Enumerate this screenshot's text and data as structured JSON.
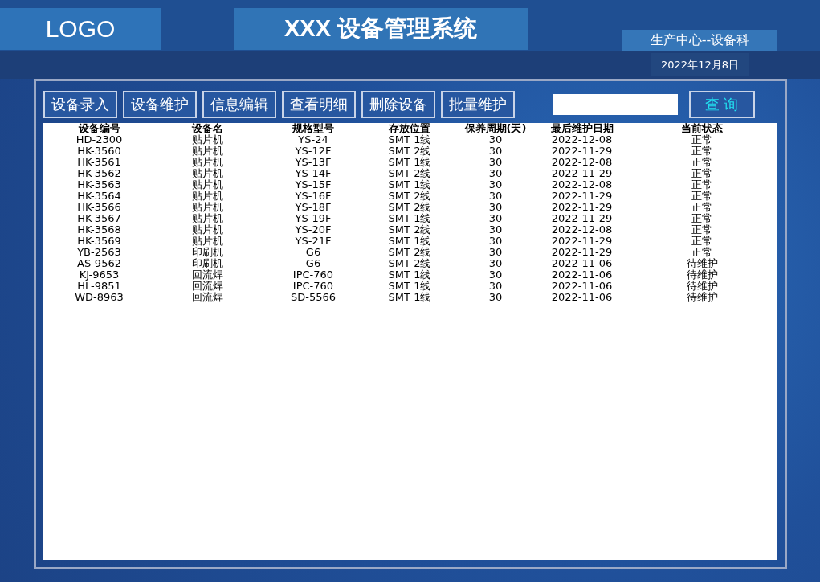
{
  "header": {
    "logo": "LOGO",
    "title": "XXX 设备管理系统",
    "department": "生产中心--设备科",
    "date": "2022年12月8日"
  },
  "toolbar": {
    "buttons": [
      "设备录入",
      "设备维护",
      "信息编辑",
      "查看明细",
      "删除设备",
      "批量维护"
    ],
    "query_button": "查 询"
  },
  "table": {
    "columns": [
      "设备编号",
      "设备名",
      "规格型号",
      "存放位置",
      "保养周期(天)",
      "最后维护日期",
      "当前状态"
    ],
    "rows": [
      [
        "HD-2300",
        "贴片机",
        "YS-24",
        "SMT 1线",
        "30",
        "2022-12-08",
        "正常"
      ],
      [
        "HK-3560",
        "贴片机",
        "YS-12F",
        "SMT 2线",
        "30",
        "2022-11-29",
        "正常"
      ],
      [
        "HK-3561",
        "贴片机",
        "YS-13F",
        "SMT 1线",
        "30",
        "2022-12-08",
        "正常"
      ],
      [
        "HK-3562",
        "贴片机",
        "YS-14F",
        "SMT 2线",
        "30",
        "2022-11-29",
        "正常"
      ],
      [
        "HK-3563",
        "贴片机",
        "YS-15F",
        "SMT 1线",
        "30",
        "2022-12-08",
        "正常"
      ],
      [
        "HK-3564",
        "贴片机",
        "YS-16F",
        "SMT 2线",
        "30",
        "2022-11-29",
        "正常"
      ],
      [
        "HK-3566",
        "贴片机",
        "YS-18F",
        "SMT 2线",
        "30",
        "2022-11-29",
        "正常"
      ],
      [
        "HK-3567",
        "贴片机",
        "YS-19F",
        "SMT 1线",
        "30",
        "2022-11-29",
        "正常"
      ],
      [
        "HK-3568",
        "贴片机",
        "YS-20F",
        "SMT 2线",
        "30",
        "2022-12-08",
        "正常"
      ],
      [
        "HK-3569",
        "贴片机",
        "YS-21F",
        "SMT 1线",
        "30",
        "2022-11-29",
        "正常"
      ],
      [
        "YB-2563",
        "印刷机",
        "G6",
        "SMT 2线",
        "30",
        "2022-11-29",
        "正常"
      ],
      [
        "AS-9562",
        "印刷机",
        "G6",
        "SMT 2线",
        "30",
        "2022-11-06",
        "待维护"
      ],
      [
        "KJ-9653",
        "回流焊",
        "IPC-760",
        "SMT 1线",
        "30",
        "2022-11-06",
        "待维护"
      ],
      [
        "HL-9851",
        "回流焊",
        "IPC-760",
        "SMT 1线",
        "30",
        "2022-11-06",
        "待维护"
      ],
      [
        "WD-8963",
        "回流焊",
        "SD-5566",
        "SMT 1线",
        "30",
        "2022-11-06",
        "待维护"
      ]
    ]
  }
}
